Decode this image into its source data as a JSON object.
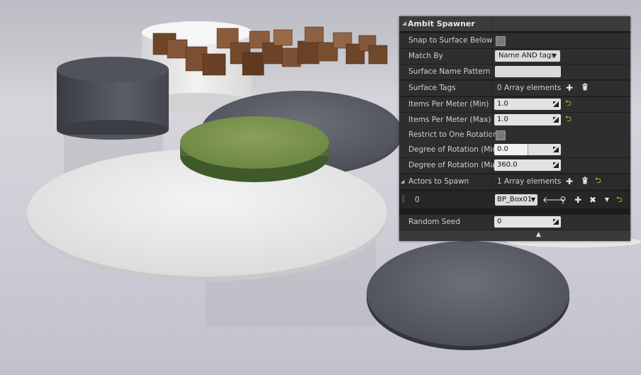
{
  "panel": {
    "title": "Ambit Spawner",
    "rows": {
      "snap": {
        "label": "Snap to Surface Below",
        "checked": false
      },
      "match_by": {
        "label": "Match By",
        "value": "Name AND tags"
      },
      "surface_name_pattern": {
        "label": "Surface Name Pattern",
        "value": ""
      },
      "surface_tags": {
        "label": "Surface Tags",
        "value": "0 Array elements"
      },
      "items_min": {
        "label": "Items Per Meter (Min)",
        "value": "1.0"
      },
      "items_max": {
        "label": "Items Per Meter (Max)",
        "value": "1.0"
      },
      "restrict_rotation": {
        "label": "Restrict to One Rotation",
        "checked": false
      },
      "rot_min": {
        "label": "Degree of Rotation (Min)",
        "value": "0.0",
        "fill_fraction": 0.5
      },
      "rot_max": {
        "label": "Degree of Rotation (Max)",
        "value": "360.0"
      },
      "actors_to_spawn": {
        "label": "Actors to Spawn",
        "value": "1 Array elements"
      },
      "actor_element": {
        "index": "0",
        "asset": "BP_Box01"
      },
      "random_seed": {
        "label": "Random Seed",
        "value": "0"
      }
    }
  },
  "colors": {
    "panel_bg": "#2e2e2e",
    "header_bg": "#3b3b3b",
    "reset_arrow": "#d8c81c"
  },
  "icons": [
    "add-icon",
    "trash-icon",
    "reset-arrow-icon",
    "resize-icon",
    "use-selected-arrow-icon",
    "browse-search-icon",
    "insert-icon",
    "clear-x-icon",
    "chevron-down-icon",
    "collapse-triangle-icon"
  ]
}
